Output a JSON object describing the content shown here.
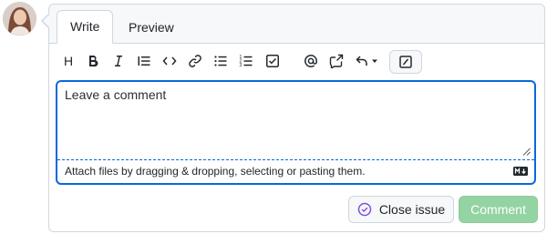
{
  "tabs": [
    {
      "label": "Write",
      "active": true
    },
    {
      "label": "Preview",
      "active": false
    }
  ],
  "toolbar": {
    "heading_label": "H",
    "items": [
      "heading-icon",
      "bold-icon",
      "italic-icon",
      "quote-icon",
      "code-icon",
      "link-icon",
      "unordered-list-icon",
      "ordered-list-icon",
      "task-list-icon",
      "mention-icon",
      "reference-icon",
      "saved-replies-icon",
      "slash-commands-icon"
    ]
  },
  "editor": {
    "placeholder": "Leave a comment",
    "value": "",
    "attach_text": "Attach files by dragging & dropping, selecting or pasting them."
  },
  "buttons": {
    "close_issue": "Close issue",
    "comment": "Comment"
  },
  "colors": {
    "accent": "#0969da",
    "comment_button": "#94d3a2",
    "close_icon": "#8250df"
  }
}
